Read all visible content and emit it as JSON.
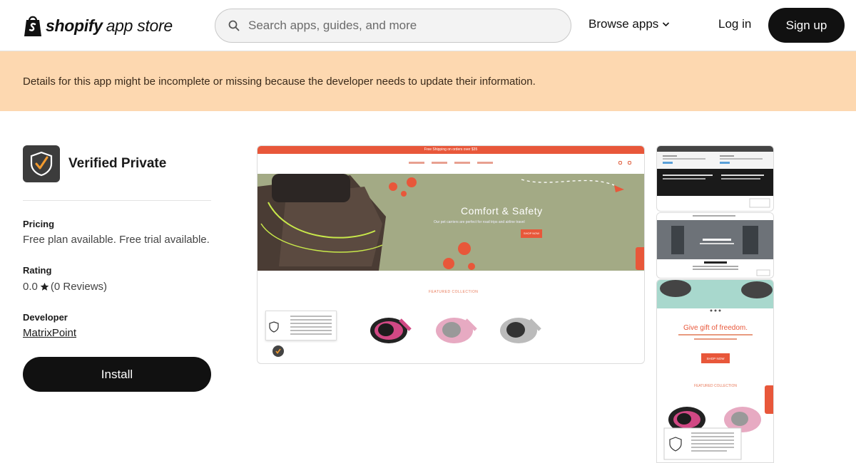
{
  "header": {
    "logo_word": "shopify",
    "logo_sub": "app store",
    "search_placeholder": "Search apps, guides, and more",
    "browse_label": "Browse apps",
    "login_label": "Log in",
    "signup_label": "Sign up"
  },
  "banner": {
    "text": "Details for this app might be incomplete or missing because the developer needs to update their information."
  },
  "app": {
    "name": "Verified Private",
    "pricing_label": "Pricing",
    "pricing_value": "Free plan available. Free trial available.",
    "rating_label": "Rating",
    "rating_value": "0.0",
    "rating_reviews": "(0 Reviews)",
    "developer_label": "Developer",
    "developer_name": "MatrixPoint",
    "install_label": "Install"
  },
  "screenshot_main": {
    "promo": "Free Shipping on orders over $35",
    "hero_title": "Comfort & Safety",
    "hero_subtitle": "Our pet carriers are perfect for road trips and airline travel",
    "hero_button": "SHOP NOW",
    "featured_label": "FEATURED COLLECTION"
  },
  "screenshot_thumb3": {
    "title": "Give gift of freedom.",
    "subtitle": "Retractable leashes allows your pup the freedom to roam",
    "button": "SHOP NOW",
    "featured_label": "FEATURED COLLECTION"
  },
  "colors": {
    "banner_bg": "#fdd8b0",
    "accent_orange": "#e8573a",
    "hero_green": "#a3aa85",
    "brand_dark": "#111111"
  }
}
